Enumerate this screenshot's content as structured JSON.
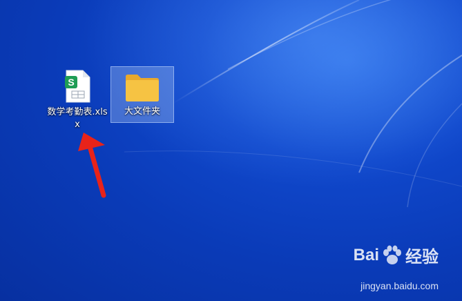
{
  "desktop": {
    "background_color": "#0a3bb8",
    "icons": [
      {
        "label": "数学考勤表.xlsx",
        "icon": "spreadsheet-file-icon",
        "badge": "S",
        "badge_color": "#1f9d55",
        "selected": false
      },
      {
        "label": "大文件夹",
        "icon": "folder-icon",
        "folder_color": "#f6c343",
        "selected": true
      }
    ]
  },
  "annotation": {
    "arrow_color": "#e8231a"
  },
  "watermark": {
    "logo_text_left": "Bai",
    "logo_text_right": "经验",
    "url": "jingyan.baidu.com"
  }
}
